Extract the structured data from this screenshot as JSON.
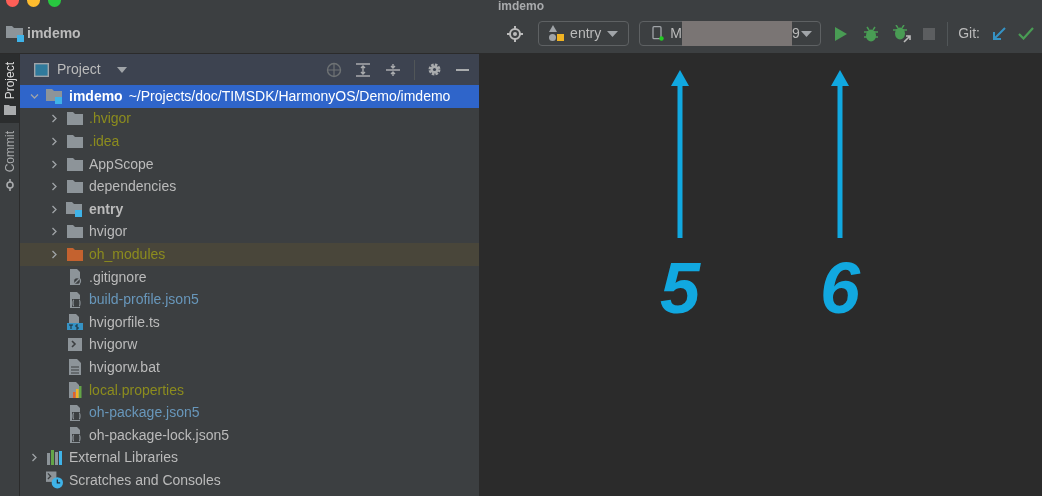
{
  "window": {
    "title": "imdemo"
  },
  "toolbar": {
    "project_name": "imdemo",
    "module_selector": "entry",
    "device_selector": {
      "prefix": "M",
      "suffix": "9"
    },
    "git_label": "Git:"
  },
  "side_tabs": [
    {
      "label": "Project",
      "selected": true
    },
    {
      "label": "Commit",
      "selected": false
    }
  ],
  "panel": {
    "title": "Project"
  },
  "tree": [
    {
      "kind": "module",
      "name": "imdemo",
      "path": "~/Projects/doc/TIMSDK/HarmonyOS/Demo/imdemo",
      "expanded": true,
      "selected": true,
      "children": [
        {
          "kind": "folder",
          "name": ".hvigor",
          "expanded": false,
          "selected": false,
          "color": "#8c8c1e"
        },
        {
          "kind": "folder",
          "name": ".idea",
          "expanded": false,
          "selected": false,
          "color": "#8c8c1e"
        },
        {
          "kind": "folder",
          "name": "AppScope",
          "expanded": false,
          "selected": false,
          "color": "#bbbbbb"
        },
        {
          "kind": "folder",
          "name": "dependencies",
          "expanded": false,
          "selected": false,
          "color": "#bbbbbb"
        },
        {
          "kind": "module",
          "name": "entry",
          "expanded": false,
          "selected": false,
          "color": "#bbbbbb"
        },
        {
          "kind": "folder",
          "name": "hvigor",
          "expanded": false,
          "selected": false,
          "color": "#bbbbbb"
        },
        {
          "kind": "excluded",
          "name": "oh_modules",
          "expanded": false,
          "selected": false,
          "color": "#8c8c1e"
        },
        {
          "kind": "gitignore",
          "name": ".gitignore",
          "selected": false,
          "color": "#bbbbbb"
        },
        {
          "kind": "json",
          "name": "build-profile.json5",
          "selected": false,
          "color": "#6897bb"
        },
        {
          "kind": "ts",
          "name": "hvigorfile.ts",
          "selected": false,
          "color": "#bbbbbb"
        },
        {
          "kind": "script",
          "name": "hvigorw",
          "selected": false,
          "color": "#bbbbbb"
        },
        {
          "kind": "text",
          "name": "hvigorw.bat",
          "selected": false,
          "color": "#bbbbbb"
        },
        {
          "kind": "properties",
          "name": "local.properties",
          "selected": false,
          "color": "#8c8c1e"
        },
        {
          "kind": "json",
          "name": "oh-package.json5",
          "selected": false,
          "color": "#6897bb"
        },
        {
          "kind": "json",
          "name": "oh-package-lock.json5",
          "selected": false,
          "color": "#bbbbbb"
        }
      ]
    },
    {
      "kind": "libraries",
      "name": "External Libraries",
      "expanded": false,
      "selected": false,
      "color": "#bbbbbb"
    },
    {
      "kind": "scratches",
      "name": "Scratches and Consoles",
      "selected": false,
      "color": "#bbbbbb"
    }
  ],
  "annotations": [
    {
      "label": "5"
    },
    {
      "label": "6"
    }
  ]
}
